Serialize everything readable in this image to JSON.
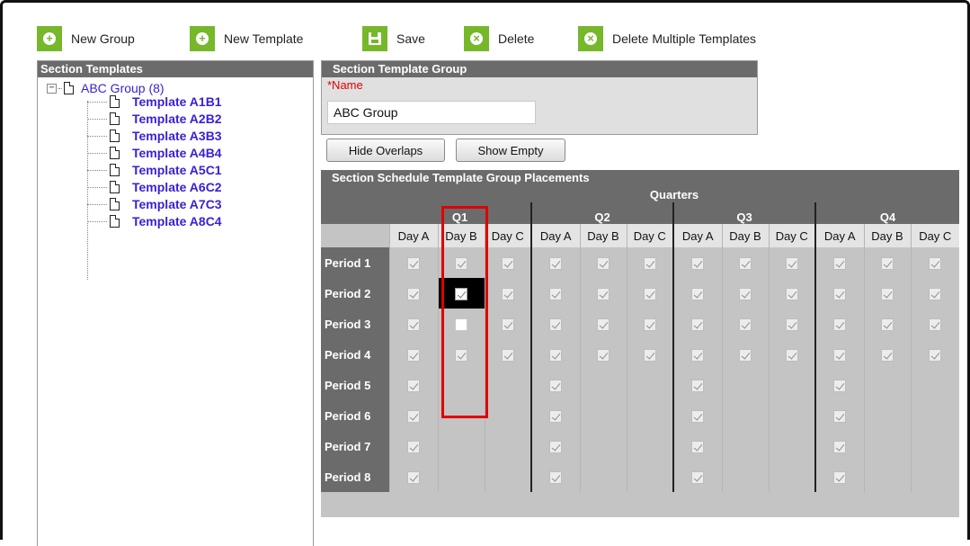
{
  "toolbar": {
    "new_group": "New Group",
    "new_template": "New Template",
    "save": "Save",
    "delete": "Delete",
    "delete_multiple": "Delete Multiple Templates"
  },
  "left_panel": {
    "title": "Section Templates",
    "root": {
      "label": "ABC Group (8)"
    },
    "items": [
      "Template A1B1",
      "Template A2B2",
      "Template A3B3",
      "Template A4B4",
      "Template A5C1",
      "Template A6C2",
      "Template A7C3",
      "Template A8C4"
    ]
  },
  "group_box": {
    "title": "Section Template Group",
    "name_label": "*Name",
    "name_value": "ABC Group"
  },
  "buttons": {
    "hide_overlaps": "Hide Overlaps",
    "show_empty": "Show Empty"
  },
  "placements": {
    "title": "Section Schedule Template Group Placements",
    "quarters_label": "Quarters",
    "quarters": [
      "Q1",
      "Q2",
      "Q3",
      "Q4"
    ],
    "days": [
      "Day A",
      "Day B",
      "Day C"
    ],
    "periods": [
      "Period 1",
      "Period 2",
      "Period 3",
      "Period 4",
      "Period 5",
      "Period 6",
      "Period 7",
      "Period 8"
    ],
    "grid": [
      [
        "on",
        "on",
        "on",
        "on",
        "on",
        "on",
        "on",
        "on",
        "on",
        "on",
        "on",
        "on"
      ],
      [
        "on",
        "focus",
        "on",
        "on",
        "on",
        "on",
        "on",
        "on",
        "on",
        "on",
        "on",
        "on"
      ],
      [
        "on",
        "empty",
        "on",
        "on",
        "on",
        "on",
        "on",
        "on",
        "on",
        "on",
        "on",
        "on"
      ],
      [
        "on",
        "on",
        "on",
        "on",
        "on",
        "on",
        "on",
        "on",
        "on",
        "on",
        "on",
        "on"
      ],
      [
        "on",
        "none",
        "none",
        "on",
        "none",
        "none",
        "on",
        "none",
        "none",
        "on",
        "none",
        "none"
      ],
      [
        "on",
        "none",
        "none",
        "on",
        "none",
        "none",
        "on",
        "none",
        "none",
        "on",
        "none",
        "none"
      ],
      [
        "on",
        "none",
        "none",
        "on",
        "none",
        "none",
        "on",
        "none",
        "none",
        "on",
        "none",
        "none"
      ],
      [
        "on",
        "none",
        "none",
        "on",
        "none",
        "none",
        "on",
        "none",
        "none",
        "on",
        "none",
        "none"
      ]
    ]
  },
  "colors": {
    "toolbar_icon": "#76b82a",
    "header": "#6b6b6b",
    "tree_link": "#3a1fd6",
    "required": "#e00000",
    "highlight": "#e00000"
  }
}
